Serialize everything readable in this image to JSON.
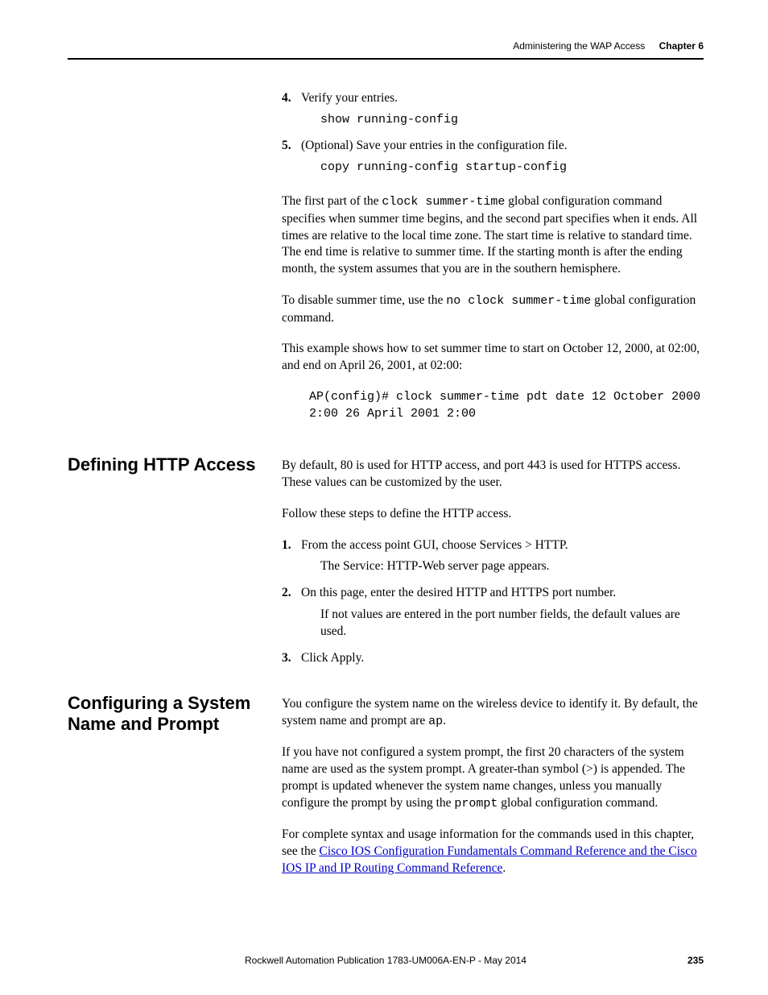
{
  "header": {
    "title": "Administering the WAP Access",
    "chapter": "Chapter 6"
  },
  "top_steps": [
    {
      "num": "4.",
      "text": "Verify your entries.",
      "code": "show running-config"
    },
    {
      "num": "5.",
      "text": "(Optional) Save your entries in the configuration file.",
      "code": "copy running-config startup-config"
    }
  ],
  "para1_pre": "The first part of the ",
  "para1_code": "clock summer-time",
  "para1_post": " global configuration command specifies when summer time begins, and the second part specifies when it ends. All times are relative to the local time zone. The start time is relative to standard time. The end time is relative to summer time. If the starting month is after the ending month, the system assumes that you are in the southern hemisphere.",
  "para2_pre": "To disable summer time, use the ",
  "para2_code": "no clock summer-time",
  "para2_post": " global configuration command.",
  "para3": "This example shows how to set summer time to start on October 12, 2000, at 02:00, and end on April 26, 2001, at 02:00:",
  "codeblock": "AP(config)# clock summer-time pdt date 12 October 2000 2:00 26 April 2001 2:00",
  "section_http": {
    "heading": "Defining HTTP Access",
    "intro": "By default, 80 is used for HTTP access, and port 443 is used for HTTPS access. These values can be customized by the user.",
    "follow": "Follow these steps to define the HTTP access.",
    "steps": [
      {
        "num": "1.",
        "text": "From the access point GUI, choose Services > HTTP.",
        "sub": "The Service: HTTP-Web server page appears."
      },
      {
        "num": "2.",
        "text": "On this page, enter the desired HTTP and HTTPS port number.",
        "sub": "If not values are entered in the port number fields, the default values are used."
      },
      {
        "num": "3.",
        "text": "Click Apply.",
        "sub": ""
      }
    ]
  },
  "section_sys": {
    "heading": "Configuring a System Name and Prompt",
    "p1_pre": "You configure the system name on the wireless device to identify it. By default, the system name and prompt are ",
    "p1_code": "ap",
    "p1_post": ".",
    "p2_pre": "If you have not configured a system prompt, the first 20 characters of the system name are used as the system prompt. A greater-than symbol (>) is appended. The prompt is updated whenever the system name changes, unless you manually configure the prompt by using the ",
    "p2_code": "prompt",
    "p2_post": " global configuration command.",
    "p3_pre": "For complete syntax and usage information for the commands used in this chapter, see the ",
    "p3_link": "Cisco IOS Configuration Fundamentals Command Reference and the Cisco IOS IP and IP Routing Command Reference",
    "p3_post": "."
  },
  "footer": {
    "pub": "Rockwell Automation Publication 1783-UM006A-EN-P - May 2014",
    "page": "235"
  }
}
